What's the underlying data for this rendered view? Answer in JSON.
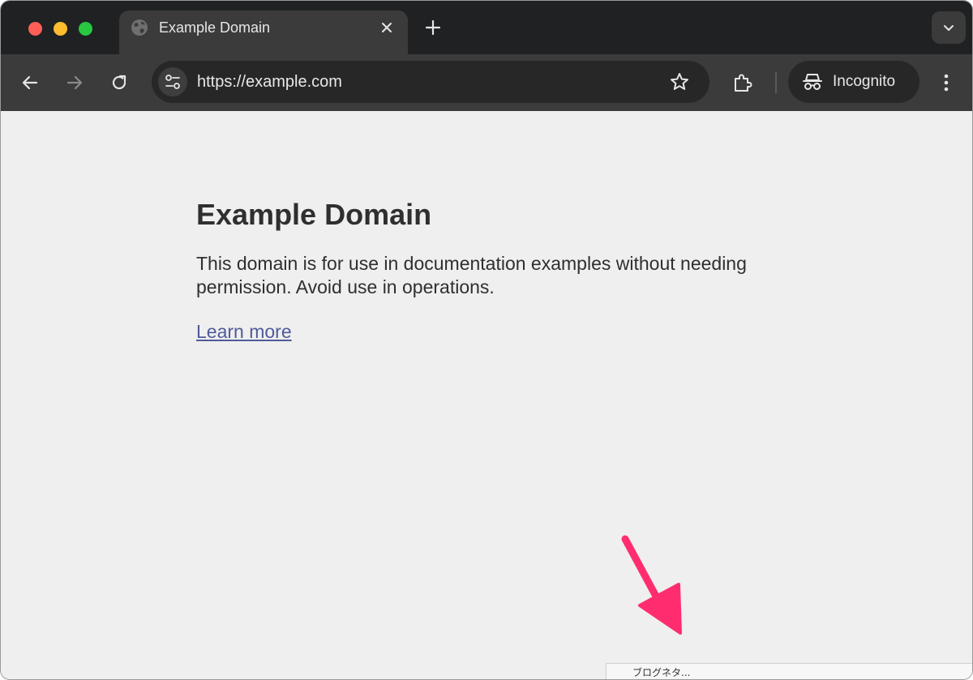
{
  "browser": {
    "tab": {
      "title": "Example Domain",
      "icon": "globe-icon"
    },
    "address_bar": {
      "url": "https://example.com"
    },
    "profile": {
      "label": "Incognito",
      "icon": "incognito-icon"
    },
    "colors": {
      "tabstrip": "#1f2122",
      "toolbar": "#3b3b3b",
      "omnibox": "#272727",
      "close": "#ff5f57",
      "minimize": "#febc2e",
      "maximize": "#28c840"
    }
  },
  "page": {
    "heading": "Example Domain",
    "body": "This domain is for use in documentation examples without needing permission. Avoid use in operations.",
    "link_text": "Learn more",
    "link_color": "#4f5b9a"
  },
  "annotation": {
    "arrow_color": "#ff2d6f",
    "arrow_icon": "arrow-pointer-icon"
  },
  "status_bar": {
    "text": "ブログネタ..."
  }
}
